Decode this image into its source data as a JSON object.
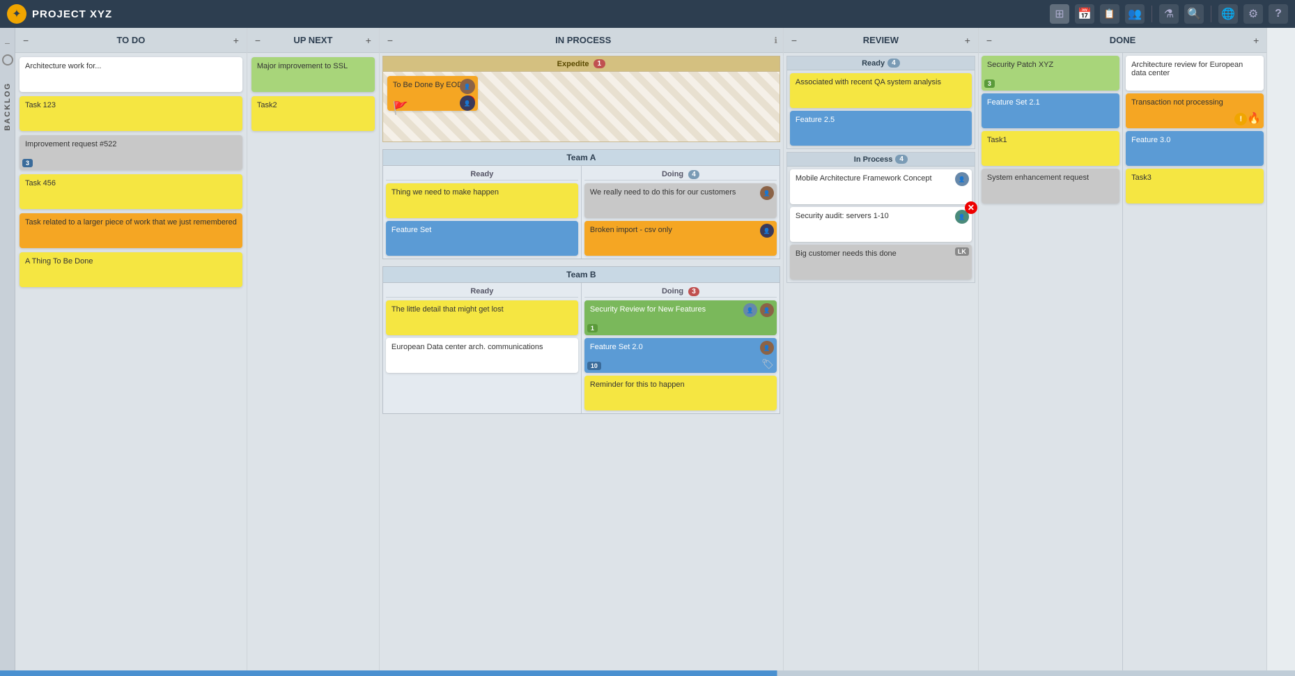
{
  "header": {
    "title": "PROJECT XYZ",
    "logo": "☀",
    "icons": [
      "grid-icon",
      "calendar-icon",
      "report-icon",
      "people-icon",
      "filter-icon",
      "search-icon",
      "help-icon",
      "settings-icon",
      "question-icon"
    ]
  },
  "columns": {
    "todo": {
      "label": "TO DO",
      "minus": "−",
      "plus": "+"
    },
    "upnext": {
      "label": "UP NEXT",
      "minus": "−",
      "plus": "+"
    },
    "inprocess": {
      "label": "IN PROCESS",
      "minus": "−",
      "info": "ℹ"
    },
    "review": {
      "label": "REVIEW",
      "minus": "−",
      "plus": "+"
    },
    "done": {
      "label": "DONE",
      "minus": "−",
      "plus": "+"
    }
  },
  "todo_cards": [
    {
      "text": "Architecture work for...",
      "color": "white"
    },
    {
      "text": "Task 123",
      "color": "yellow"
    },
    {
      "text": "Improvement request #522",
      "color": "gray",
      "badge": "3"
    },
    {
      "text": "Task 456",
      "color": "yellow"
    },
    {
      "text": "Task related to a larger piece of work that we just remembered",
      "color": "orange"
    },
    {
      "text": "A Thing To Be Done",
      "color": "yellow"
    }
  ],
  "upnext_cards": [
    {
      "text": "Major improvement to SSL",
      "color": "green"
    },
    {
      "text": "Task2",
      "color": "yellow"
    }
  ],
  "expedite": {
    "label": "Expedite",
    "count": "1",
    "card": {
      "text": "To Be Done By EOD!",
      "color": "orange",
      "has_flag": true,
      "has_alert": true
    }
  },
  "team_a": {
    "label": "Team A",
    "ready_cards": [
      {
        "text": "Thing we need to make happen",
        "color": "yellow"
      },
      {
        "text": "Feature Set",
        "color": "blue"
      }
    ],
    "doing_count": "4",
    "doing_cards": [
      {
        "text": "We really need to do this for our customers",
        "color": "gray",
        "has_avatar": true
      },
      {
        "text": "Broken import - csv only",
        "color": "orange",
        "has_avatar": true
      }
    ]
  },
  "team_b": {
    "label": "Team B",
    "ready_cards": [
      {
        "text": "The little detail that might get lost",
        "color": "yellow"
      },
      {
        "text": "European Data center arch. communications",
        "color": "white"
      }
    ],
    "doing_count": "3",
    "doing_cards": [
      {
        "text": "Security Review for New Features",
        "color": "green-dark",
        "has_avatar": true,
        "badge": "1",
        "badge_color": "green"
      },
      {
        "text": "Feature Set 2.0",
        "color": "blue",
        "has_avatar": true,
        "badge": "10"
      },
      {
        "text": "Reminder for this to happen",
        "color": "yellow"
      }
    ]
  },
  "review": {
    "ready": {
      "label": "Ready",
      "count": "4",
      "cards": [
        {
          "text": "Associated with recent QA system analysis",
          "color": "yellow"
        },
        {
          "text": "Feature 2.5",
          "color": "blue"
        }
      ]
    },
    "inprocess": {
      "label": "In Process",
      "count": "4",
      "cards": [
        {
          "text": "Mobile Architecture Framework Concept",
          "color": "white",
          "has_avatar": true
        },
        {
          "text": "Security audit: servers 1-10",
          "color": "white",
          "has_avatar": true,
          "has_x": true
        },
        {
          "text": "Big customer needs this done",
          "color": "gray",
          "lk": "LK"
        }
      ]
    }
  },
  "done_cards": [
    {
      "text": "Security Patch XYZ",
      "color": "green",
      "badge": "3"
    },
    {
      "text": "Architecture review for European data center",
      "color": "white"
    },
    {
      "text": "Feature Set 2.1",
      "color": "blue"
    },
    {
      "text": "Transaction not processing",
      "color": "orange",
      "has_exclaim": true
    },
    {
      "text": "Task1",
      "color": "yellow"
    },
    {
      "text": "Feature 3.0",
      "color": "blue"
    },
    {
      "text": "System enhancement request",
      "color": "gray"
    },
    {
      "text": "Task3",
      "color": "yellow"
    }
  ]
}
